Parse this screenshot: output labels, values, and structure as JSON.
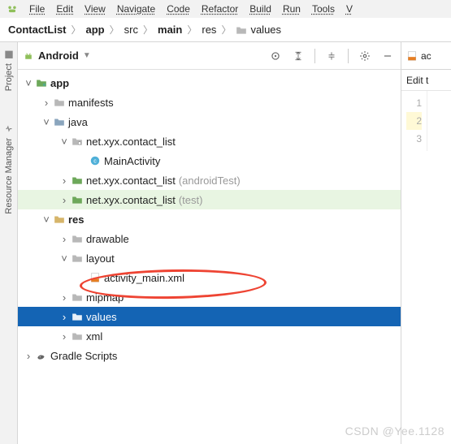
{
  "menu": {
    "file": "File",
    "edit": "Edit",
    "view": "View",
    "navigate": "Navigate",
    "code": "Code",
    "refactor": "Refactor",
    "build": "Build",
    "run": "Run",
    "tools": "Tools",
    "v": "V"
  },
  "breadcrumb": {
    "root": "ContactList",
    "app": "app",
    "src": "src",
    "main": "main",
    "res": "res",
    "values": "values"
  },
  "sidebar": {
    "project": "Project",
    "resmgr": "Resource Manager"
  },
  "toolbar": {
    "selector": "Android",
    "dropdown": "▼"
  },
  "tree": {
    "app": "app",
    "manifests": "manifests",
    "java": "java",
    "pkg1": "net.xyx.contact_list",
    "main_act": "MainActivity",
    "pkg_at": "net.xyx.contact_list",
    "pkg_at_suffix": "(androidTest)",
    "pkg_t": "net.xyx.contact_list",
    "pkg_t_suffix": "(test)",
    "res": "res",
    "drawable": "drawable",
    "layout": "layout",
    "act_main": "activity_main.xml",
    "mipmap": "mipmap",
    "values": "values",
    "xml": "xml",
    "gradle": "Gradle Scripts"
  },
  "editor": {
    "tab": "ac",
    "bar": "Edit t",
    "l1": "1",
    "l2": "2",
    "l3": "3"
  },
  "watermark": "CSDN @Yee.1128"
}
